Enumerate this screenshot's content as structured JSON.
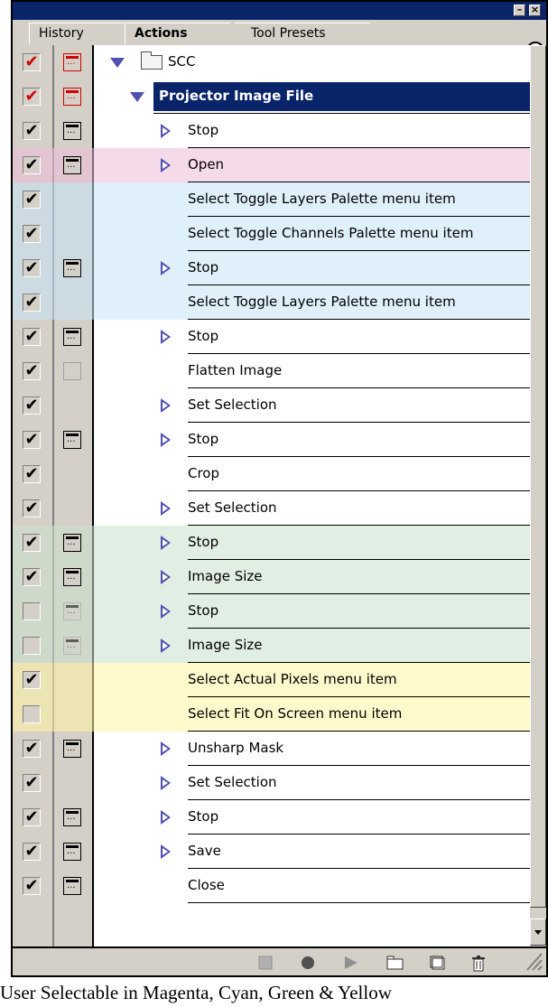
{
  "tabs": [
    {
      "label": "History",
      "active": false
    },
    {
      "label": "Actions",
      "active": true
    },
    {
      "label": "Tool Presets",
      "active": false
    }
  ],
  "colors": {
    "magenta": "#ecbcd8",
    "cyan": "#c4e4f6",
    "green": "#c8e0cc",
    "yellow": "#fff4a0",
    "title_bar": "#0a246a",
    "selected_row": "#0a246a"
  },
  "actions": [
    {
      "label": "SCC",
      "type": "set",
      "check": "red",
      "dialog": "red",
      "expand": "down",
      "highlight": null
    },
    {
      "label": "Projector Image File",
      "type": "action",
      "check": "red",
      "dialog": "red",
      "expand": "down",
      "highlight": null,
      "selected": true
    },
    {
      "label": "Stop",
      "type": "command",
      "check": "checked",
      "dialog": "on",
      "expand": "right",
      "highlight": null
    },
    {
      "label": "Open",
      "type": "command",
      "check": "checked",
      "dialog": "on",
      "expand": "right",
      "highlight": "magenta"
    },
    {
      "label": "Select Toggle Layers Palette menu item",
      "type": "command",
      "check": "checked",
      "dialog": "none",
      "expand": null,
      "highlight": "cyan"
    },
    {
      "label": "Select Toggle Channels Palette menu item",
      "type": "command",
      "check": "checked",
      "dialog": "none",
      "expand": null,
      "highlight": "cyan"
    },
    {
      "label": "Stop",
      "type": "command",
      "check": "checked",
      "dialog": "on",
      "expand": "right",
      "highlight": "cyan"
    },
    {
      "label": "Select Toggle Layers Palette menu item",
      "type": "command",
      "check": "checked",
      "dialog": "none",
      "expand": null,
      "highlight": "cyan"
    },
    {
      "label": "Stop",
      "type": "command",
      "check": "checked",
      "dialog": "on",
      "expand": "right",
      "highlight": null
    },
    {
      "label": "Flatten Image",
      "type": "command",
      "check": "checked",
      "dialog": "blank",
      "expand": null,
      "highlight": null
    },
    {
      "label": "Set Selection",
      "type": "command",
      "check": "checked",
      "dialog": "none",
      "expand": "right",
      "highlight": null
    },
    {
      "label": "Stop",
      "type": "command",
      "check": "checked",
      "dialog": "on",
      "expand": "right",
      "highlight": null
    },
    {
      "label": "Crop",
      "type": "command",
      "check": "checked",
      "dialog": "none",
      "expand": null,
      "highlight": null
    },
    {
      "label": "Set Selection",
      "type": "command",
      "check": "checked",
      "dialog": "none",
      "expand": "right",
      "highlight": null
    },
    {
      "label": "Stop",
      "type": "command",
      "check": "checked",
      "dialog": "on",
      "expand": "right",
      "highlight": "green"
    },
    {
      "label": "Image Size",
      "type": "command",
      "check": "checked",
      "dialog": "on",
      "expand": "right",
      "highlight": "green"
    },
    {
      "label": "Stop",
      "type": "command",
      "check": "unchecked",
      "dialog": "faded",
      "expand": "right",
      "highlight": "green"
    },
    {
      "label": "Image Size",
      "type": "command",
      "check": "unchecked",
      "dialog": "faded",
      "expand": "right",
      "highlight": "green"
    },
    {
      "label": "Select Actual Pixels menu item",
      "type": "command",
      "check": "checked",
      "dialog": "none",
      "expand": null,
      "highlight": "yellow"
    },
    {
      "label": "Select Fit On Screen menu item",
      "type": "command",
      "check": "unchecked",
      "dialog": "none",
      "expand": null,
      "highlight": "yellow"
    },
    {
      "label": "Unsharp Mask",
      "type": "command",
      "check": "checked",
      "dialog": "on",
      "expand": "right",
      "highlight": null
    },
    {
      "label": "Set Selection",
      "type": "command",
      "check": "checked",
      "dialog": "none",
      "expand": "right",
      "highlight": null
    },
    {
      "label": "Stop",
      "type": "command",
      "check": "checked",
      "dialog": "on",
      "expand": "right",
      "highlight": null
    },
    {
      "label": "Save",
      "type": "command",
      "check": "checked",
      "dialog": "on",
      "expand": "right",
      "highlight": null
    },
    {
      "label": "Close",
      "type": "command",
      "check": "checked",
      "dialog": "on",
      "expand": null,
      "highlight": null
    }
  ],
  "footer_icons": [
    "stop-icon",
    "record-icon",
    "play-icon",
    "new-set-icon",
    "new-action-icon",
    "trash-icon"
  ],
  "caption": "User Selectable in Magenta, Cyan, Green & Yellow"
}
